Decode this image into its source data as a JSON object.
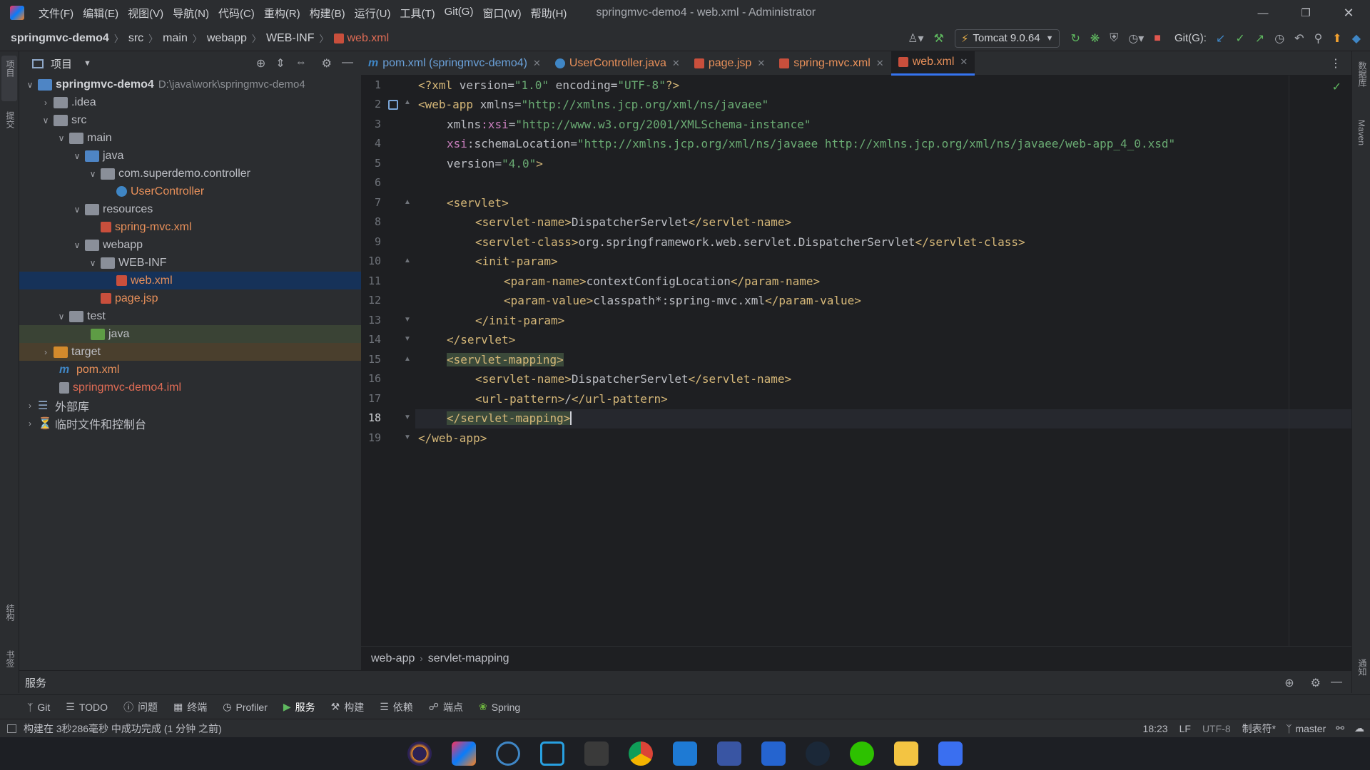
{
  "window": {
    "title": "springmvc-demo4 - web.xml - Administrator",
    "menu": [
      "文件(F)",
      "编辑(E)",
      "视图(V)",
      "导航(N)",
      "代码(C)",
      "重构(R)",
      "构建(B)",
      "运行(U)",
      "工具(T)",
      "Git(G)",
      "窗口(W)",
      "帮助(H)"
    ]
  },
  "breadcrumb": {
    "items": [
      "springmvc-demo4",
      "src",
      "main",
      "webapp",
      "WEB-INF",
      "web.xml"
    ]
  },
  "toolbar": {
    "run_config": "Tomcat 9.0.64",
    "git_label": "Git(G):"
  },
  "left_strip": {
    "project": "项目",
    "commit": "提交",
    "structure": "结构",
    "bookmarks": "书签"
  },
  "right_strip": {
    "database": "数据库",
    "maven": "Maven",
    "notifications": "通知"
  },
  "project_panel": {
    "title": "项目",
    "tree": [
      {
        "label": "springmvc-demo4",
        "path": "D:\\java\\work\\springmvc-demo4"
      },
      {
        "label": ".idea"
      },
      {
        "label": "src"
      },
      {
        "label": "main"
      },
      {
        "label": "java"
      },
      {
        "label": "com.superdemo.controller"
      },
      {
        "label": "UserController"
      },
      {
        "label": "resources"
      },
      {
        "label": "spring-mvc.xml"
      },
      {
        "label": "webapp"
      },
      {
        "label": "WEB-INF"
      },
      {
        "label": "web.xml"
      },
      {
        "label": "page.jsp"
      },
      {
        "label": "test"
      },
      {
        "label": "java"
      },
      {
        "label": "target"
      },
      {
        "label": "pom.xml"
      },
      {
        "label": "springmvc-demo4.iml"
      },
      {
        "label": "外部库"
      },
      {
        "label": "临时文件和控制台"
      }
    ]
  },
  "editor_tabs": [
    {
      "label": "pom.xml (springmvc-demo4)"
    },
    {
      "label": "UserController.java"
    },
    {
      "label": "page.jsp"
    },
    {
      "label": "spring-mvc.xml"
    },
    {
      "label": "web.xml"
    }
  ],
  "code": {
    "line_numbers": [
      "1",
      "2",
      "3",
      "4",
      "5",
      "6",
      "7",
      "8",
      "9",
      "10",
      "11",
      "12",
      "13",
      "14",
      "15",
      "16",
      "17",
      "18",
      "19"
    ],
    "l1": {
      "a": "<?xml ",
      "b": "version",
      "c": "=",
      "d": "\"1.0\"",
      "e": " encoding",
      "f": "=",
      "g": "\"UTF-8\"",
      "h": "?>"
    },
    "l2": {
      "a": "<web-app ",
      "b": "xmlns",
      "c": "=",
      "d": "\"http://xmlns.jcp.org/xml/ns/javaee\""
    },
    "l3": {
      "a": "xmlns",
      "b": ":xsi",
      "c": "=",
      "d": "\"http://www.w3.org/2001/XMLSchema-instance\""
    },
    "l4": {
      "a": "xsi",
      "b": ":schemaLocation",
      "c": "=",
      "d": "\"http://xmlns.jcp.org/xml/ns/javaee http://xmlns.jcp.org/xml/ns/javaee/web-app_4_0.xsd\""
    },
    "l5": {
      "a": "version",
      "b": "=",
      "c": "\"4.0\"",
      "d": ">"
    },
    "l7": "<servlet>",
    "l8": {
      "open": "<servlet-name>",
      "text": "DispatcherServlet",
      "close": "</servlet-name>"
    },
    "l9": {
      "open": "<servlet-class>",
      "text": "org.springframework.web.servlet.DispatcherServlet",
      "close": "</servlet-class>"
    },
    "l10": "<init-param>",
    "l11": {
      "open": "<param-name>",
      "text": "contextConfigLocation",
      "close": "</param-name>"
    },
    "l12": {
      "open": "<param-value>",
      "text": "classpath*:spring-mvc.xml",
      "close": "</param-value>"
    },
    "l13": "</init-param>",
    "l14": "</servlet>",
    "l15": "<servlet-mapping>",
    "l16": {
      "open": "<servlet-name>",
      "text": "DispatcherServlet",
      "close": "</servlet-name>"
    },
    "l17": {
      "open": "<url-pattern>",
      "text": "/",
      "close": "</url-pattern>"
    },
    "l18": "</servlet-mapping>",
    "l19": "</web-app>"
  },
  "editor_breadcrumb": [
    "web-app",
    "servlet-mapping"
  ],
  "services": {
    "title": "服务"
  },
  "tool_tabs": [
    "Git",
    "TODO",
    "问题",
    "终端",
    "Profiler",
    "服务",
    "构建",
    "依赖",
    "端点",
    "Spring"
  ],
  "status": {
    "message": "构建在 3秒286毫秒 中成功完成 (1 分钟 之前)",
    "position": "18:23",
    "line_sep": "LF",
    "encoding": "UTF-8",
    "indent": "制表符*",
    "branch": "master"
  },
  "colors": {
    "accent": "#3574f0",
    "selection": "#163259",
    "tag": "#d5b778",
    "value": "#6aab73"
  }
}
